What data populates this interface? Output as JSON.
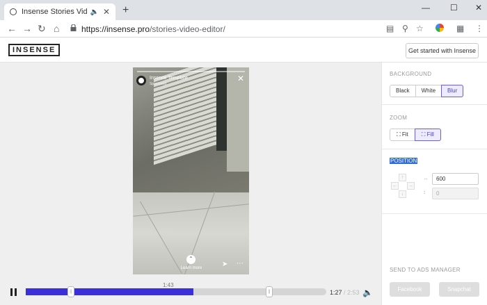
{
  "browser": {
    "tab_title": "Insense Stories Video Editor",
    "new_tab_label": "+",
    "url_host": "https://insense.pro",
    "url_path": "/stories-video-editor/"
  },
  "site": {
    "logo": "INSENSE",
    "get_started_label": "Get started with Insense"
  },
  "video": {
    "account_name": "Insense Template",
    "sponsored_label": "Sponsored",
    "learn_more_label": "Learn more"
  },
  "timeline": {
    "marker_label": "1:43",
    "current_time": "1:27",
    "separator": " / ",
    "total_time": "2:53",
    "progress_fraction": 0.558,
    "trim_start_fraction": 0.15,
    "trim_end_fraction": 0.81
  },
  "panel": {
    "background": {
      "title": "BACKGROUND",
      "options": [
        "Black",
        "White",
        "Blur"
      ],
      "selected": "Blur"
    },
    "zoom": {
      "title": "ZOOM",
      "options": [
        "Fit",
        "Fill"
      ],
      "selected": "Fill"
    },
    "position": {
      "title": "POSITION",
      "x_value": "600",
      "y_placeholder": "0"
    },
    "ads": {
      "title": "SEND TO ADS MANAGER",
      "facebook_label": "Facebook",
      "snapchat_label": "Snapchat"
    }
  },
  "colors": {
    "accent": "#3a2fd8",
    "selected_bg": "#ecebff",
    "selection_highlight": "#2f6bd6"
  }
}
